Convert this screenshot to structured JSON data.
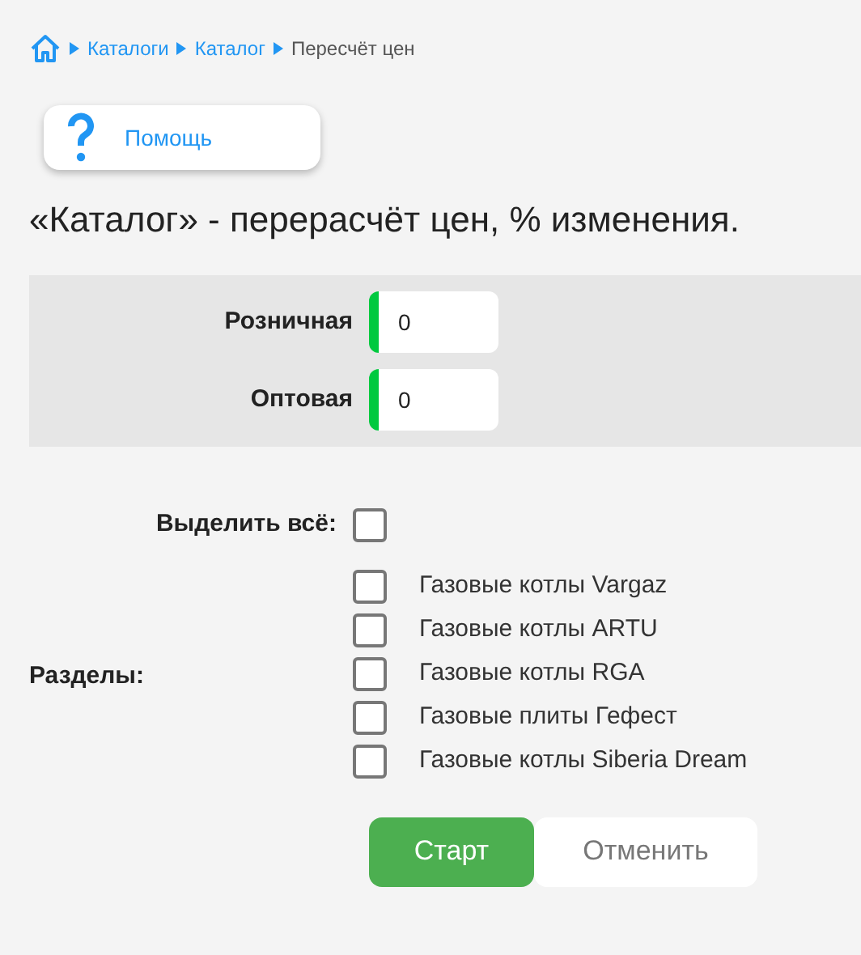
{
  "breadcrumb": [
    {
      "label": "Каталоги",
      "kind": "link"
    },
    {
      "label": "Каталог",
      "kind": "link"
    },
    {
      "label": "Пересчёт цен",
      "kind": "current"
    }
  ],
  "help_button": {
    "label": "Помощь"
  },
  "title": "«Каталог» - перерасчёт цен, % изменения.",
  "price_fields": [
    {
      "label": "Розничная",
      "value": "0"
    },
    {
      "label": "Оптовая",
      "value": "0"
    }
  ],
  "select_all": {
    "label": "Выделить всё:",
    "checked": false
  },
  "sections": {
    "label": "Разделы:",
    "items": [
      {
        "label": "Газовые котлы Vargaz",
        "checked": false
      },
      {
        "label": "Газовые котлы ARTU",
        "checked": false
      },
      {
        "label": "Газовые котлы RGA",
        "checked": false
      },
      {
        "label": "Газовые плиты Гефест",
        "checked": false
      },
      {
        "label": "Газовые котлы Siberia Dream",
        "checked": false
      }
    ]
  },
  "buttons": {
    "start": "Старт",
    "cancel": "Отменить"
  }
}
